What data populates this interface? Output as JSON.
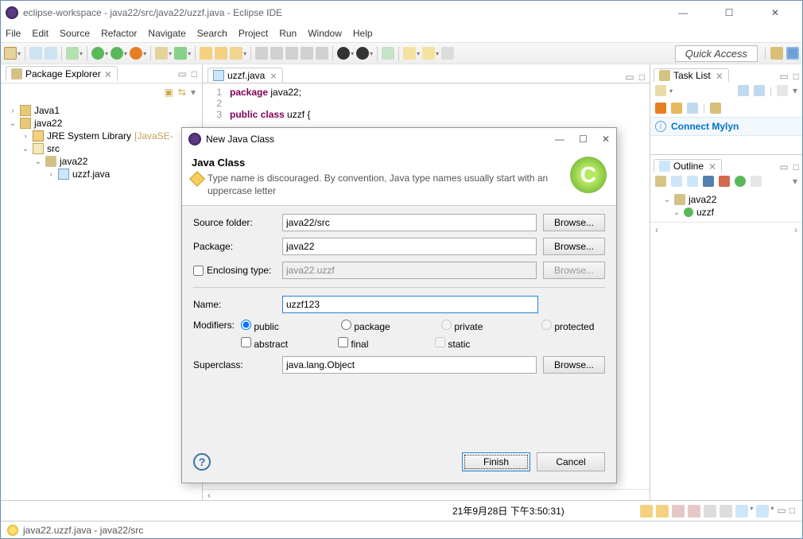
{
  "titlebar": {
    "title": "eclipse-workspace - java22/src/java22/uzzf.java - Eclipse IDE"
  },
  "menubar": [
    "File",
    "Edit",
    "Source",
    "Refactor",
    "Navigate",
    "Search",
    "Project",
    "Run",
    "Window",
    "Help"
  ],
  "toolbar": {
    "quick_access": "Quick Access"
  },
  "package_explorer": {
    "title": "Package Explorer",
    "nodes": {
      "java1": "Java1",
      "java22": "java22",
      "jre": "JRE System Library",
      "jre_suffix": "[JavaSE-",
      "src": "src",
      "pkg": "java22",
      "file": "uzzf.java"
    }
  },
  "editor": {
    "tab": "uzzf.java",
    "lines": {
      "l1_kw": "package",
      "l1_rest": " java22;",
      "l3_kw1": "public",
      "l3_kw2": "class",
      "l3_name": " uzzf {"
    }
  },
  "tasklist": {
    "title": "Task List",
    "connect": "Connect Mylyn"
  },
  "outline": {
    "title": "Outline",
    "pkg": "java22",
    "class": "uzzf"
  },
  "console_status": "21年9月28日 下午3:50:31)",
  "statusbar": {
    "msg": "java22.uzzf.java - java22/src"
  },
  "dialog": {
    "title": "New Java Class",
    "heading": "Java Class",
    "warning": "Type name is discouraged. By convention, Java type names usually start with an uppercase letter",
    "source_folder_label": "Source folder:",
    "source_folder": "java22/src",
    "package_label": "Package:",
    "package": "java22",
    "enclosing_label": "Enclosing type:",
    "enclosing": "java22.uzzf",
    "name_label": "Name:",
    "name": "uzzf123",
    "modifiers_label": "Modifiers:",
    "mod_public": "public",
    "mod_package": "package",
    "mod_private": "private",
    "mod_protected": "protected",
    "mod_abstract": "abstract",
    "mod_final": "final",
    "mod_static": "static",
    "superclass_label": "Superclass:",
    "superclass": "java.lang.Object",
    "browse": "Browse...",
    "finish": "Finish",
    "cancel": "Cancel"
  }
}
